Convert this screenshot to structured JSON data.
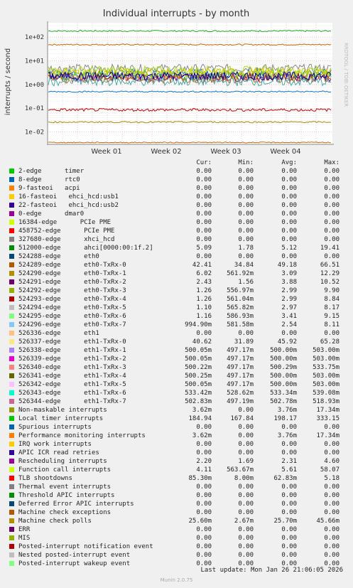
{
  "chart_data": {
    "type": "line",
    "title": "Individual interrupts - by month",
    "ylabel": "interrupts / second",
    "yscale": "log",
    "ylim": [
      0.003,
      400
    ],
    "ytick_labels": [
      "1e-02",
      "1e-01",
      "1e+00",
      "1e+01",
      "1e+02"
    ],
    "xtick_labels": [
      "Week 01",
      "Week 02",
      "Week 03",
      "Week 04"
    ],
    "grid": true,
    "side_text": "RRDTOOL / TOBI OETIKER",
    "traces": [
      {
        "color": "#22aa22",
        "level": 180
      },
      {
        "color": "#cc6600",
        "level": 48
      },
      {
        "color": "#888888",
        "level": 4.8
      },
      {
        "color": "#1f78b4",
        "level": 3.0
      },
      {
        "color": "#3c9f3c",
        "level": 2.2
      },
      {
        "color": "#aadd11",
        "level": 4.0
      },
      {
        "color": "#99cc00",
        "level": 2.6
      },
      {
        "color": "#e0d000",
        "level": 3.2
      },
      {
        "color": "#880088",
        "level": 2.0
      },
      {
        "color": "#d06000",
        "level": 1.7
      },
      {
        "color": "#44aaaa",
        "level": 1.3
      },
      {
        "color": "#0000aa",
        "level": 2.3
      },
      {
        "color": "#1177cc",
        "level": 0.5
      },
      {
        "color": "#cc0000",
        "level": 0.085
      },
      {
        "color": "#aa8800",
        "level": 0.026
      },
      {
        "color": "#cc6600",
        "level": 0.0036
      }
    ],
    "columns": [
      "Cur:",
      "Min:",
      "Avg:",
      "Max:"
    ],
    "series": [
      {
        "color": "#00cc00",
        "name": "2-edge      timer",
        "cur": "0.00",
        "min": "0.00",
        "avg": "0.00",
        "max": "0.00"
      },
      {
        "color": "#0066b3",
        "name": "8-edge      rtc0",
        "cur": "0.00",
        "min": "0.00",
        "avg": "0.00",
        "max": "0.00"
      },
      {
        "color": "#ff8000",
        "name": "9-fasteoi   acpi",
        "cur": "0.00",
        "min": "0.00",
        "avg": "0.00",
        "max": "0.00"
      },
      {
        "color": "#ffcc00",
        "name": "16-fasteoi   ehci_hcd:usb1",
        "cur": "0.00",
        "min": "0.00",
        "avg": "0.00",
        "max": "0.00"
      },
      {
        "color": "#330099",
        "name": "22-fasteoi   ehci_hcd:usb2",
        "cur": "0.00",
        "min": "0.00",
        "avg": "0.00",
        "max": "0.00"
      },
      {
        "color": "#990099",
        "name": "0-edge      dmar0",
        "cur": "0.00",
        "min": "0.00",
        "avg": "0.00",
        "max": "0.00"
      },
      {
        "color": "#ccff00",
        "name": "16384-edge      PCIe PME",
        "cur": "0.00",
        "min": "0.00",
        "avg": "0.00",
        "max": "0.00"
      },
      {
        "color": "#ff0000",
        "name": "458752-edge      PCIe PME",
        "cur": "0.00",
        "min": "0.00",
        "avg": "0.00",
        "max": "0.00"
      },
      {
        "color": "#808080",
        "name": "327680-edge      xhci_hcd",
        "cur": "0.00",
        "min": "0.00",
        "avg": "0.00",
        "max": "0.00"
      },
      {
        "color": "#008f00",
        "name": "512000-edge      ahci[0000:00:1f.2]",
        "cur": "5.09",
        "min": "1.78",
        "avg": "5.12",
        "max": "19.41"
      },
      {
        "color": "#00487d",
        "name": "524288-edge      eth0",
        "cur": "0.00",
        "min": "0.00",
        "avg": "0.00",
        "max": "0.00"
      },
      {
        "color": "#b35a00",
        "name": "524289-edge      eth0-TxRx-0",
        "cur": "42.41",
        "min": "34.84",
        "avg": "49.18",
        "max": "66.51"
      },
      {
        "color": "#b38f00",
        "name": "524290-edge      eth0-TxRx-1",
        "cur": "6.02",
        "min": "561.92m",
        "avg": "3.09",
        "max": "12.29"
      },
      {
        "color": "#6b006b",
        "name": "524291-edge      eth0-TxRx-2",
        "cur": "2.43",
        "min": "1.56",
        "avg": "3.88",
        "max": "10.52"
      },
      {
        "color": "#8fb300",
        "name": "524292-edge      eth0-TxRx-3",
        "cur": "1.26",
        "min": "556.97m",
        "avg": "2.99",
        "max": "9.90"
      },
      {
        "color": "#b30000",
        "name": "524293-edge      eth0-TxRx-4",
        "cur": "1.26",
        "min": "561.04m",
        "avg": "2.99",
        "max": "8.84"
      },
      {
        "color": "#bebebe",
        "name": "524294-edge      eth0-TxRx-5",
        "cur": "1.10",
        "min": "565.82m",
        "avg": "2.97",
        "max": "8.17"
      },
      {
        "color": "#80ff80",
        "name": "524295-edge      eth0-TxRx-6",
        "cur": "1.16",
        "min": "586.93m",
        "avg": "3.41",
        "max": "9.15"
      },
      {
        "color": "#80c9ff",
        "name": "524296-edge      eth0-TxRx-7",
        "cur": "994.90m",
        "min": "581.58m",
        "avg": "2.54",
        "max": "8.11"
      },
      {
        "color": "#ffc080",
        "name": "526336-edge      eth1",
        "cur": "0.00",
        "min": "0.00",
        "avg": "0.00",
        "max": "0.00"
      },
      {
        "color": "#ffe680",
        "name": "526337-edge      eth1-TxRx-0",
        "cur": "40.62",
        "min": "31.89",
        "avg": "45.92",
        "max": "65.28"
      },
      {
        "color": "#aa80ff",
        "name": "526338-edge      eth1-TxRx-1",
        "cur": "500.05m",
        "min": "497.17m",
        "avg": "500.00m",
        "max": "503.00m"
      },
      {
        "color": "#ee00cc",
        "name": "526339-edge      eth1-TxRx-2",
        "cur": "500.05m",
        "min": "497.17m",
        "avg": "500.00m",
        "max": "503.00m"
      },
      {
        "color": "#ff8080",
        "name": "526340-edge      eth1-TxRx-3",
        "cur": "500.22m",
        "min": "497.17m",
        "avg": "500.29m",
        "max": "533.75m"
      },
      {
        "color": "#666600",
        "name": "526341-edge      eth1-TxRx-4",
        "cur": "500.25m",
        "min": "497.17m",
        "avg": "500.00m",
        "max": "503.00m"
      },
      {
        "color": "#ffbfff",
        "name": "526342-edge      eth1-TxRx-5",
        "cur": "500.05m",
        "min": "497.17m",
        "avg": "500.00m",
        "max": "503.00m"
      },
      {
        "color": "#00ffcc",
        "name": "526343-edge      eth1-TxRx-6",
        "cur": "533.42m",
        "min": "528.62m",
        "avg": "533.34m",
        "max": "539.08m"
      },
      {
        "color": "#cc6699",
        "name": "526344-edge      eth1-TxRx-7",
        "cur": "502.83m",
        "min": "497.19m",
        "avg": "502.78m",
        "max": "518.93m"
      },
      {
        "color": "#999900",
        "name": "Non-maskable interrupts",
        "cur": "3.62m",
        "min": "0.00",
        "avg": "3.76m",
        "max": "17.34m"
      },
      {
        "color": "#00cc00",
        "name": "Local timer interrupts",
        "cur": "184.94",
        "min": "167.84",
        "avg": "198.17",
        "max": "333.15"
      },
      {
        "color": "#0066b3",
        "name": "Spurious interrupts",
        "cur": "0.00",
        "min": "0.00",
        "avg": "0.00",
        "max": "0.00"
      },
      {
        "color": "#ff8000",
        "name": "Performance monitoring interrupts",
        "cur": "3.62m",
        "min": "0.00",
        "avg": "3.76m",
        "max": "17.34m"
      },
      {
        "color": "#ffcc00",
        "name": "IRQ work interrupts",
        "cur": "0.00",
        "min": "0.00",
        "avg": "0.00",
        "max": "0.00"
      },
      {
        "color": "#330099",
        "name": "APIC ICR read retries",
        "cur": "0.00",
        "min": "0.00",
        "avg": "0.00",
        "max": "0.00"
      },
      {
        "color": "#990099",
        "name": "Rescheduling interrupts",
        "cur": "2.20",
        "min": "1.69",
        "avg": "2.31",
        "max": "4.60"
      },
      {
        "color": "#ccff00",
        "name": "Function call interrupts",
        "cur": "4.11",
        "min": "563.67m",
        "avg": "5.61",
        "max": "58.07"
      },
      {
        "color": "#ff0000",
        "name": "TLB shootdowns",
        "cur": "85.30m",
        "min": "8.00m",
        "avg": "62.83m",
        "max": "5.18"
      },
      {
        "color": "#808080",
        "name": "Thermal event interrupts",
        "cur": "0.00",
        "min": "0.00",
        "avg": "0.00",
        "max": "0.00"
      },
      {
        "color": "#008f00",
        "name": "Threshold APIC interrupts",
        "cur": "0.00",
        "min": "0.00",
        "avg": "0.00",
        "max": "0.00"
      },
      {
        "color": "#00487d",
        "name": "Deferred Error APIC interrupts",
        "cur": "0.00",
        "min": "0.00",
        "avg": "0.00",
        "max": "0.00"
      },
      {
        "color": "#b35a00",
        "name": "Machine check exceptions",
        "cur": "0.00",
        "min": "0.00",
        "avg": "0.00",
        "max": "0.00"
      },
      {
        "color": "#b38f00",
        "name": "Machine check polls",
        "cur": "25.60m",
        "min": "2.67m",
        "avg": "25.70m",
        "max": "45.66m"
      },
      {
        "color": "#6b006b",
        "name": "ERR",
        "cur": "0.00",
        "min": "0.00",
        "avg": "0.00",
        "max": "0.00"
      },
      {
        "color": "#8fb300",
        "name": "MIS",
        "cur": "0.00",
        "min": "0.00",
        "avg": "0.00",
        "max": "0.00"
      },
      {
        "color": "#b30000",
        "name": "Posted-interrupt notification event",
        "cur": "0.00",
        "min": "0.00",
        "avg": "0.00",
        "max": "0.00"
      },
      {
        "color": "#bebebe",
        "name": "Nested posted-interrupt event",
        "cur": "0.00",
        "min": "0.00",
        "avg": "0.00",
        "max": "0.00"
      },
      {
        "color": "#80ff80",
        "name": "Posted-interrupt wakeup event",
        "cur": "0.00",
        "min": "0.00",
        "avg": "0.00",
        "max": "0.00"
      }
    ]
  },
  "footer": {
    "last_update": "Last update: Mon Jan 26 21:06:05 2026",
    "version": "Munin 2.0.75"
  }
}
